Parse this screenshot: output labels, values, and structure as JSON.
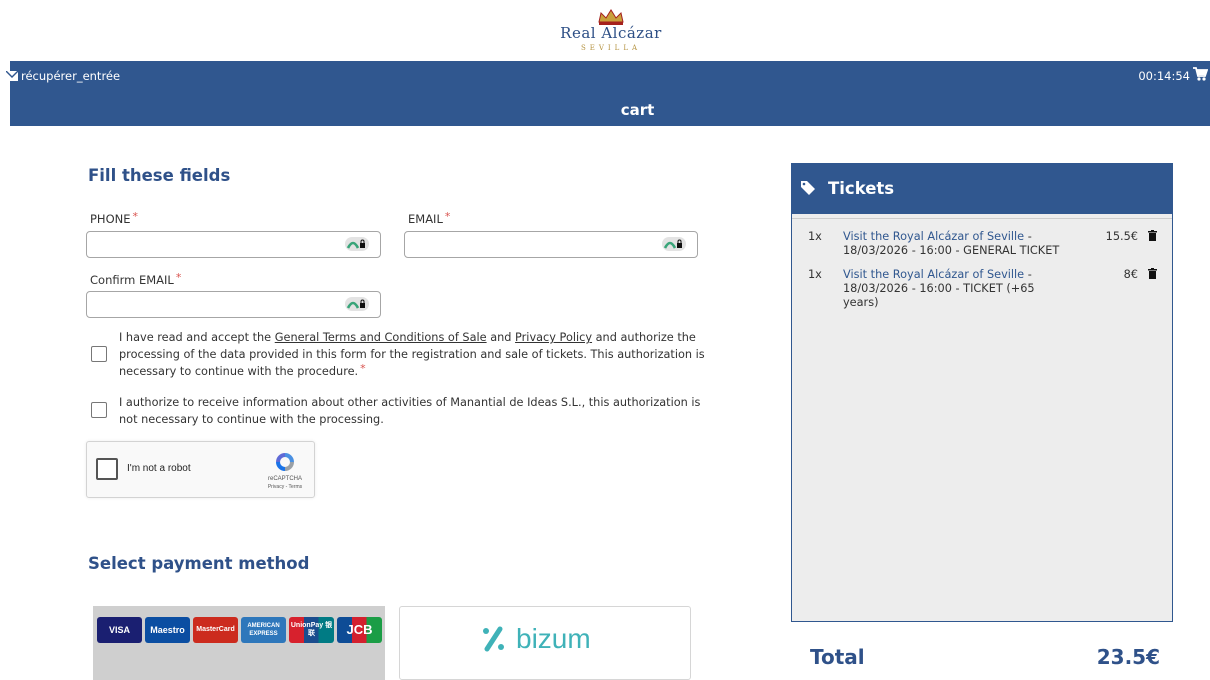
{
  "header": {
    "logo_name": "Real Alcázar",
    "logo_city": "SEVILLA",
    "retrieve_label": "récupérer_entrée",
    "timer": "00:14:54",
    "page_title": "cart"
  },
  "form": {
    "title": "Fill these fields",
    "required_mark": "*",
    "phone": {
      "label": "PHONE",
      "value": ""
    },
    "email": {
      "label": "EMAIL",
      "value": ""
    },
    "confirm_email": {
      "label": "Confirm EMAIL",
      "value": ""
    },
    "terms": {
      "part1": "I have read and accept the ",
      "link1": "General Terms and Conditions of Sale",
      "part2": " and ",
      "link2": "Privacy Policy",
      "part3": " and authorize the processing of the data provided in this form for the registration and sale of tickets. This authorization is necessary to continue with the procedure.",
      "checked": false
    },
    "marketing": {
      "text": "I authorize to receive information about other activities of Manantial de Ideas S.L., this authorization is not necessary to continue with the processing.",
      "checked": false
    },
    "recaptcha": {
      "label": "I'm not a robot",
      "brand": "reCAPTCHA",
      "links": "Privacy - Terms"
    }
  },
  "payment": {
    "title": "Select payment method",
    "cards": [
      "VISA",
      "Maestro",
      "MasterCard",
      "AMERICAN EXPRESS",
      "UnionPay 银联",
      "JCB"
    ],
    "bizum_label": "bizum"
  },
  "tickets": {
    "title": "Tickets",
    "items": [
      {
        "qty": "1x",
        "name": "Visit the Royal Alcázar of Seville",
        "detail": " - 18/03/2026 - 16:00 - GENERAL TICKET",
        "price": "15.5€"
      },
      {
        "qty": "1x",
        "name": "Visit the Royal Alcázar of Seville",
        "detail": " - 18/03/2026 - 16:00 - TICKET (+65 years)",
        "price": "8€"
      }
    ],
    "total_label": "Total",
    "total_value": "23.5€"
  },
  "colors": {
    "primary": "#30578f",
    "required": "#d9534f",
    "bizum": "#3fb2b8"
  }
}
